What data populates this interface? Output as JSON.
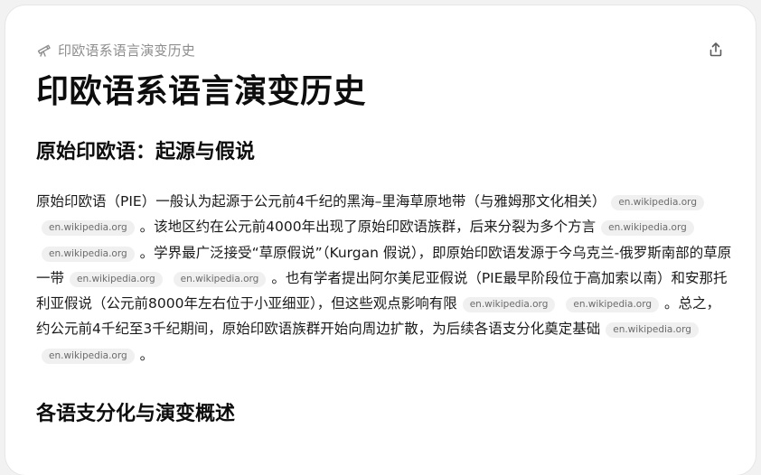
{
  "header": {
    "breadcrumb": "印欧语系语言演变历史",
    "breadcrumb_icon": "telescope-icon",
    "share_icon": "share-icon"
  },
  "page": {
    "title": "印欧语系语言演变历史"
  },
  "sections": [
    {
      "heading": "原始印欧语：起源与假说"
    },
    {
      "heading": "各语支分化与演变概述"
    }
  ],
  "paragraph": {
    "t1": "原始印欧语（PIE）一般认为起源于公元前4千纪的黑海–里海草原地带（与雅姆那文化相关）",
    "t2": "。该地区约在公元前4000年出现了原始印欧语族群，后来分裂为多个方言",
    "t3": "。学界最广泛接受“草原假说”（Kurgan 假说），即原始印欧语发源于今乌克兰-俄罗斯南部的草原一带",
    "t4": "。也有学者提出阿尔美尼亚假说（PIE最早阶段位于高加索以南）和安那托利亚假说（公元前8000年左右位于小亚细亚），但这些观点影响有限",
    "t5": "。总之，约公元前4千纪至3千纪期间，原始印欧语族群开始向周边扩散，为后续各语支分化奠定基础",
    "t6": "。",
    "citation_label": "en.wikipedia.org"
  },
  "colors": {
    "muted_text": "#8e8e8e",
    "citation_bg": "#f0f0f0",
    "page_bg": "#f2f2f2"
  }
}
